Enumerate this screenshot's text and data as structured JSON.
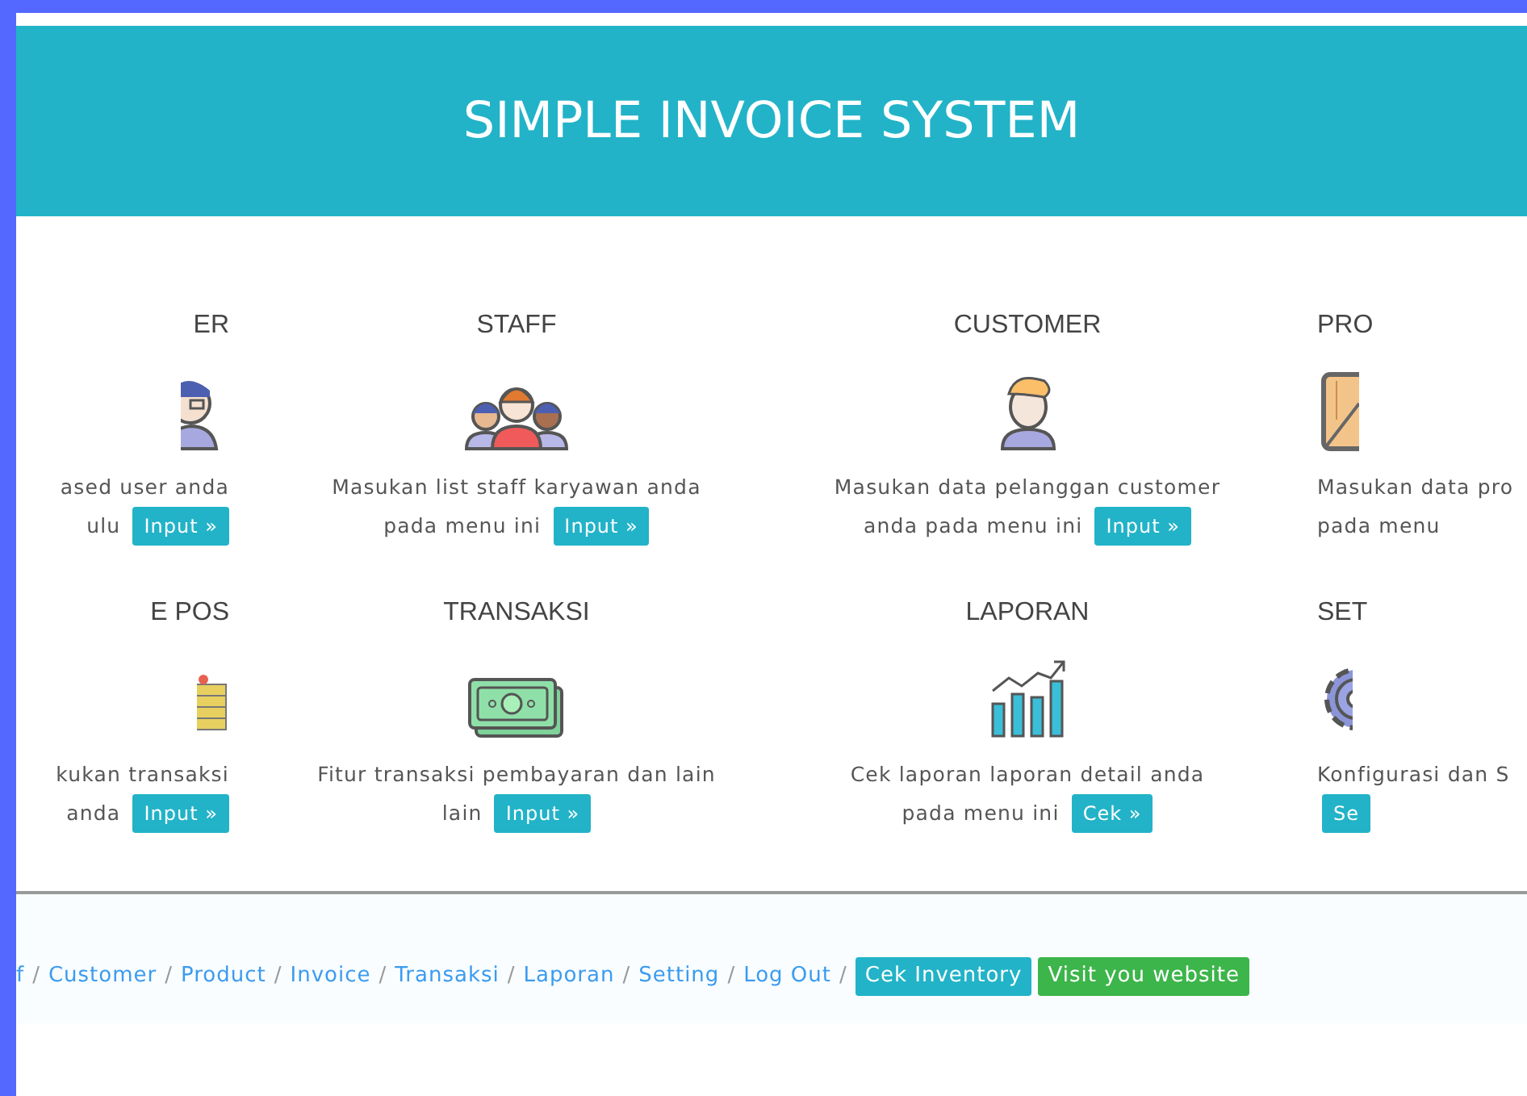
{
  "header": {
    "title": "SIMPLE INVOICE SYSTEM"
  },
  "modules": [
    {
      "title": "ER",
      "kind": "user",
      "lines": [
        "ased user anda",
        "ulu"
      ],
      "button": "Input »"
    },
    {
      "title": "STAFF",
      "kind": "staff",
      "lines": [
        "Masukan list staff karyawan anda",
        "pada menu ini"
      ],
      "button": "Input »"
    },
    {
      "title": "CUSTOMER",
      "kind": "customer",
      "lines": [
        "Masukan data pelanggan customer",
        "anda pada menu ini"
      ],
      "button": "Input »"
    },
    {
      "title": "PRO",
      "kind": "crate",
      "lines": [
        "Masukan data pro",
        "pada menu"
      ]
    },
    {
      "title": "E POS",
      "kind": "coins",
      "lines": [
        "kukan transaksi",
        "anda"
      ],
      "button": "Input »"
    },
    {
      "title": "TRANSAKSI",
      "kind": "money",
      "lines": [
        "Fitur transaksi pembayaran dan lain",
        "lain"
      ],
      "button": "Input »"
    },
    {
      "title": "LAPORAN",
      "kind": "chart",
      "lines": [
        "Cek laporan laporan detail anda",
        "pada menu ini"
      ],
      "button": "Cek »"
    },
    {
      "title": "SET",
      "kind": "gear",
      "lines": [
        "Konfigurasi dan S"
      ],
      "button": "Se"
    }
  ],
  "footer": {
    "links": [
      {
        "label": "f",
        "separator": "/"
      },
      {
        "label": "Customer",
        "separator": "/"
      },
      {
        "label": "Product",
        "separator": "/"
      },
      {
        "label": "Invoice",
        "separator": "/"
      },
      {
        "label": "Transaksi",
        "separator": "/"
      },
      {
        "label": "Laporan",
        "separator": "/"
      },
      {
        "label": "Setting",
        "separator": "/"
      },
      {
        "label": "Log Out",
        "separator": "/"
      }
    ],
    "badges": [
      {
        "label": "Cek Inventory",
        "color": "#22b3c8"
      },
      {
        "label": "Visit you website",
        "color": "#3cb54a"
      }
    ]
  }
}
